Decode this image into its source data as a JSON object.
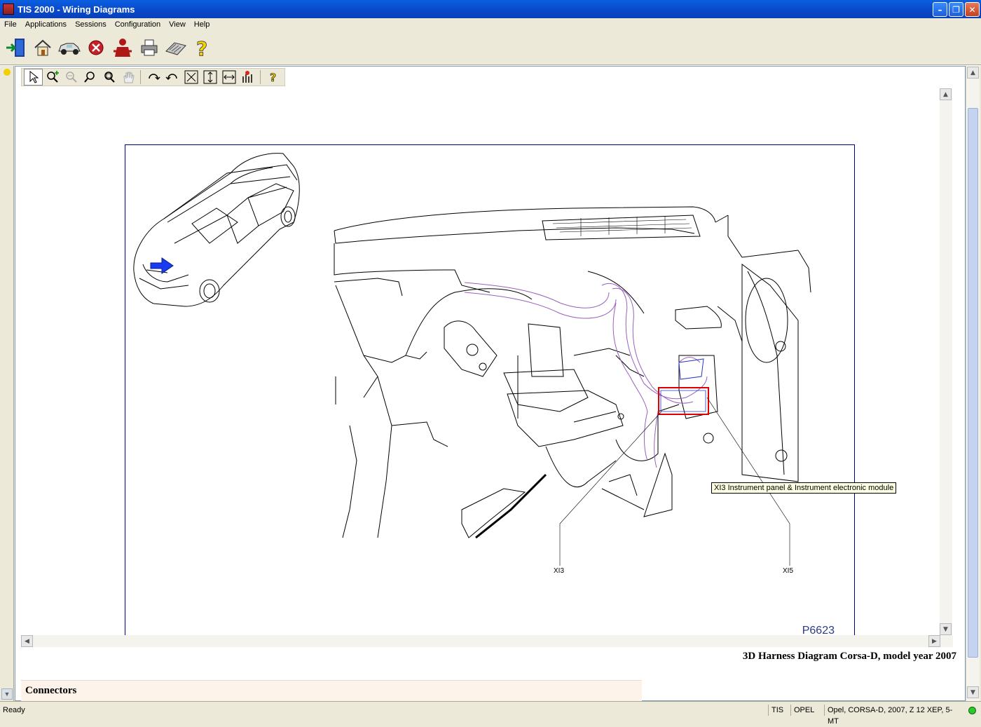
{
  "window": {
    "title": "TIS 2000 - Wiring Diagrams"
  },
  "menu": {
    "items": [
      "File",
      "Applications",
      "Sessions",
      "Configuration",
      "View",
      "Help"
    ]
  },
  "main_toolbar": {
    "icons": [
      "exit-icon",
      "home-icon",
      "vehicle-icon",
      "stop-icon",
      "user-icon",
      "print-icon",
      "keyboard-icon",
      "help-icon"
    ]
  },
  "diagram_toolbar": {
    "icons": [
      "select-arrow-icon",
      "zoom-in-icon",
      "zoom-out-icon",
      "zoom-icon",
      "zoom-window-icon",
      "pan-hand-icon",
      "rotate-right-icon",
      "rotate-left-icon",
      "fit-all-icon",
      "fit-height-icon",
      "fit-width-icon",
      "layers-icon",
      "help-icon"
    ]
  },
  "diagram": {
    "drawing_id": "P6623",
    "labels": {
      "xi3": "XI3",
      "xi5": "XI5"
    },
    "tooltip": "XI3 Instrument panel & Instrument electronic module",
    "caption": "3D Harness Diagram Corsa-D, model year 2007"
  },
  "connectors_panel": {
    "heading": "Connectors"
  },
  "status": {
    "text": "Ready",
    "app": "TIS",
    "make": "OPEL",
    "vehicle": "Opel, CORSA-D, 2007, Z 12 XEP, 5-MT"
  },
  "colors": {
    "harness": "#9b5fbf",
    "highlight": "#e00000",
    "frame": "#000080"
  }
}
